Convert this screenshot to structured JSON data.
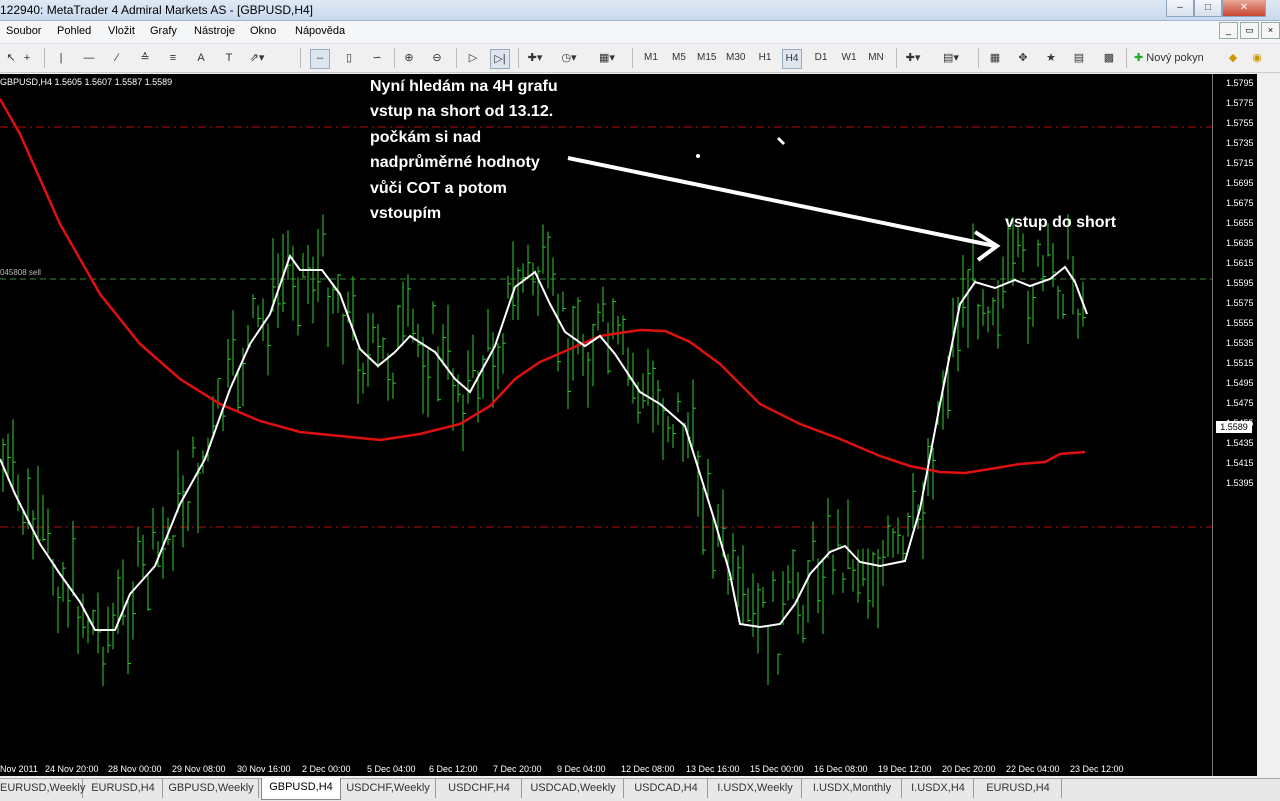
{
  "window": {
    "title": "122940: MetaTrader 4 Admiral Markets AS - [GBPUSD,H4]",
    "minimize_icon": "minimize-icon",
    "maximize_icon": "maximize-icon",
    "close_icon": "close-icon"
  },
  "menu": {
    "items": [
      "Soubor",
      "Pohled",
      "Vložit",
      "Grafy",
      "Nástroje",
      "Okno",
      "Nápověda"
    ]
  },
  "toolbar": {
    "timeframes": [
      "M1",
      "M5",
      "M15",
      "M30",
      "H1",
      "H4",
      "D1",
      "W1",
      "MN"
    ],
    "active_timeframe": "H4",
    "new_order_label": "Nový pokyn"
  },
  "chart": {
    "info": "GBPUSD,H4  1.5605 1.5607 1.5587 1.5589",
    "sell_label": "045808 sell",
    "current_price": "1.5589",
    "y_labels": [
      "1.5795",
      "1.5775",
      "1.5755",
      "1.5735",
      "1.5715",
      "1.5695",
      "1.5675",
      "1.5655",
      "1.5635",
      "1.5615",
      "1.5595",
      "1.5575",
      "1.5555",
      "1.5535",
      "1.5515",
      "1.5495",
      "1.5475",
      "1.5455",
      "1.5435",
      "1.5415",
      "1.5395"
    ],
    "x_labels": [
      "Nov 2011",
      "24 Nov 20:00",
      "28 Nov 00:00",
      "29 Nov 08:00",
      "30 Nov 16:00",
      "2 Dec 00:00",
      "5 Dec 04:00",
      "6 Dec 12:00",
      "7 Dec 20:00",
      "9 Dec 04:00",
      "12 Dec 08:00",
      "13 Dec 16:00",
      "15 Dec 00:00",
      "16 Dec 08:00",
      "19 Dec 12:00",
      "20 Dec 20:00",
      "22 Dec 04:00",
      "23 Dec 12:00"
    ],
    "annotation_lines": [
      "Nyní hledám na 4H grafu",
      "vstup na short od 13.12.",
      "počkám si nad",
      "nadprůměrné hodnoty",
      "vůči COT a potom",
      "vstoupím"
    ],
    "annotation_2": "vstup do short",
    "colors": {
      "background": "#000000",
      "bars": "#33cc33",
      "ma_slow": "#e01010",
      "ma_fast": "#ffffff",
      "levels": "#b01010"
    }
  },
  "tabs": {
    "items": [
      "EURUSD,Weekly",
      "EURUSD,H4",
      "GBPUSD,Weekly",
      "GBPUSD,H4",
      "USDCHF,Weekly",
      "USDCHF,H4",
      "USDCAD,Weekly",
      "USDCAD,H4",
      "I.USDX,Weekly",
      "I.USDX,Monthly",
      "I.USDX,H4",
      "EURUSD,H4"
    ],
    "active_index": 3
  }
}
